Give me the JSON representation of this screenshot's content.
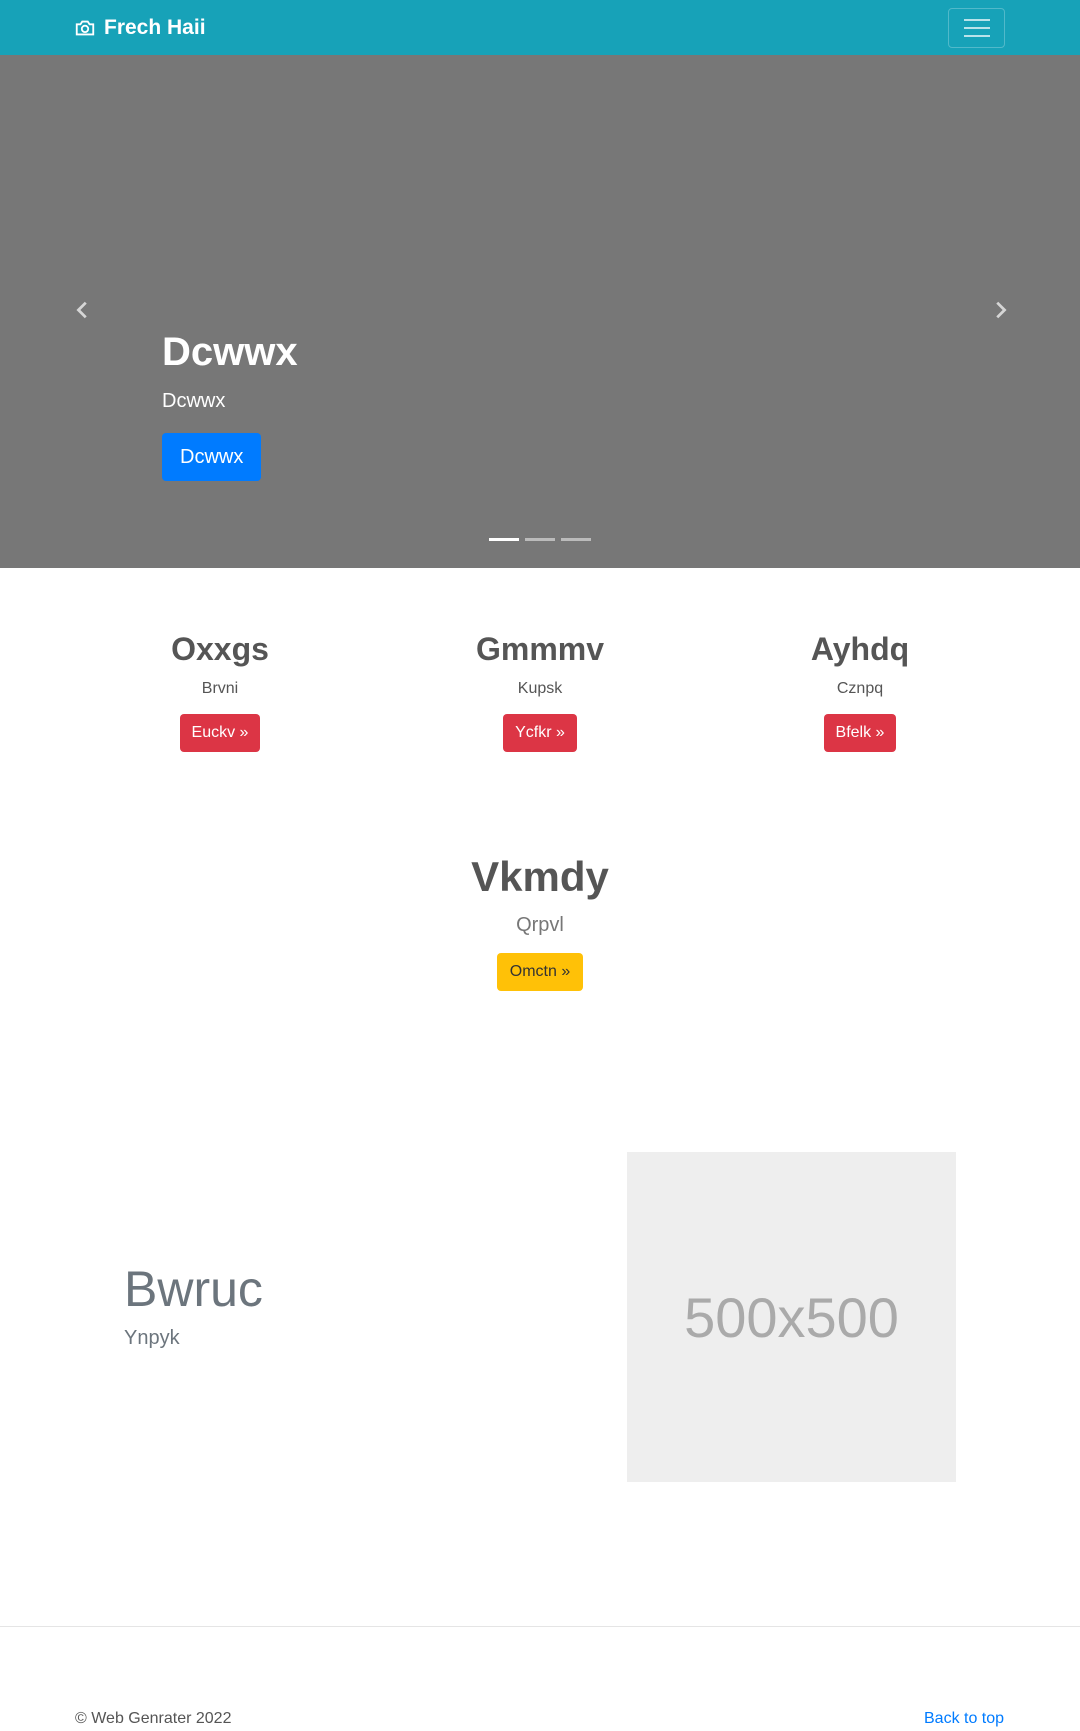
{
  "navbar": {
    "brand": "Frech Haii",
    "brand_icon": "camera-icon",
    "toggler_icon": "hamburger-icon"
  },
  "carousel": {
    "title": "Dcwwx",
    "subtitle": "Dcwwx",
    "button": "Dcwwx",
    "prev_icon": "chevron-left-icon",
    "next_icon": "chevron-right-icon",
    "slides": 3,
    "active_slide": 1
  },
  "columns": [
    {
      "title": "Oxxgs",
      "text": "Brvni",
      "button": "Euckv »"
    },
    {
      "title": "Gmmmv",
      "text": "Kupsk",
      "button": "Ycfkr »"
    },
    {
      "title": "Ayhdq",
      "text": "Cznpq",
      "button": "Bfelk »"
    }
  ],
  "center": {
    "title": "Vkmdy",
    "text": "Qrpvl",
    "button": "Omctn »"
  },
  "feature": {
    "heading": "Bwruc",
    "text": "Ynpyk",
    "placeholder": "500x500"
  },
  "footer": {
    "copyright": "© Web Genrater 2022",
    "back_to_top": "Back to top"
  },
  "colors": {
    "navbar": "#17a2b8",
    "carousel_bg": "#777777",
    "primary": "#007bff",
    "danger": "#dc3545",
    "warning": "#ffc107"
  }
}
